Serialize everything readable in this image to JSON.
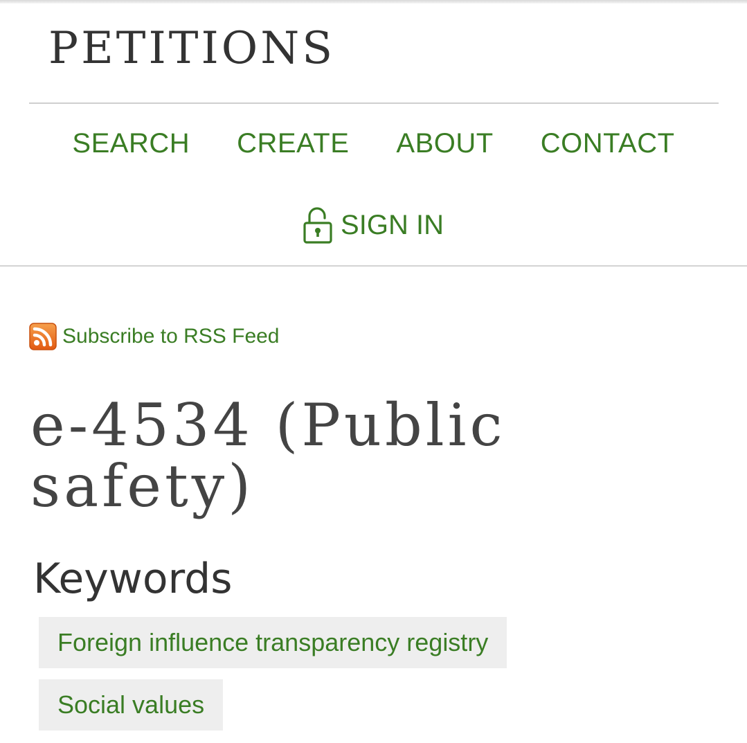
{
  "site": {
    "title": "PETITIONS"
  },
  "nav": {
    "items": [
      {
        "label": "SEARCH"
      },
      {
        "label": "CREATE"
      },
      {
        "label": "ABOUT"
      },
      {
        "label": "CONTACT"
      }
    ],
    "signin_label": "SIGN IN",
    "signin_icon": "unlock-icon"
  },
  "rss": {
    "label": "Subscribe to RSS Feed",
    "icon": "rss-feed-icon"
  },
  "petition": {
    "title": "e-4534 (Public safety)"
  },
  "keywords": {
    "heading": "Keywords",
    "items": [
      {
        "label": "Foreign influence transparency registry"
      },
      {
        "label": "Social values"
      }
    ]
  },
  "colors": {
    "link_green": "#3a7d24",
    "rss_orange": "#f26a1b",
    "keyword_bg": "#eeeeee",
    "title_text": "#444444"
  }
}
